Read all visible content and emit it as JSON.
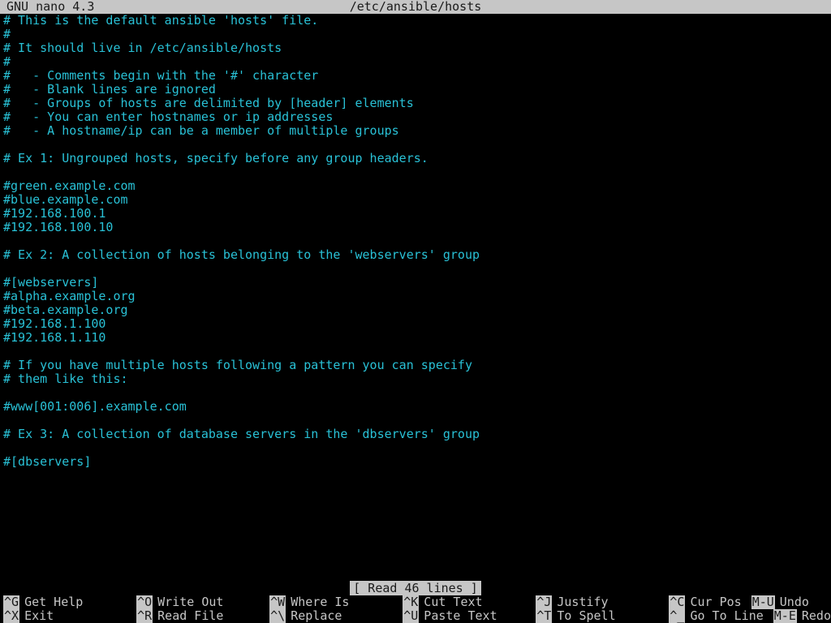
{
  "titlebar": {
    "app": "GNU nano 4.3",
    "file": "/etc/ansible/hosts"
  },
  "content_lines": [
    "# This is the default ansible 'hosts' file.",
    "#",
    "# It should live in /etc/ansible/hosts",
    "#",
    "#   - Comments begin with the '#' character",
    "#   - Blank lines are ignored",
    "#   - Groups of hosts are delimited by [header] elements",
    "#   - You can enter hostnames or ip addresses",
    "#   - A hostname/ip can be a member of multiple groups",
    "",
    "# Ex 1: Ungrouped hosts, specify before any group headers.",
    "",
    "#green.example.com",
    "#blue.example.com",
    "#192.168.100.1",
    "#192.168.100.10",
    "",
    "# Ex 2: A collection of hosts belonging to the 'webservers' group",
    "",
    "#[webservers]",
    "#alpha.example.org",
    "#beta.example.org",
    "#192.168.1.100",
    "#192.168.1.110",
    "",
    "# If you have multiple hosts following a pattern you can specify",
    "# them like this:",
    "",
    "#www[001:006].example.com",
    "",
    "# Ex 3: A collection of database servers in the 'dbservers' group",
    "",
    "#[dbservers]"
  ],
  "statusbar": {
    "message": "[ Read 46 lines ]"
  },
  "shortcuts": {
    "row1": [
      {
        "key": "^G",
        "label": "Get Help"
      },
      {
        "key": "^O",
        "label": "Write Out"
      },
      {
        "key": "^W",
        "label": "Where Is"
      },
      {
        "key": "^K",
        "label": "Cut Text"
      },
      {
        "key": "^J",
        "label": "Justify"
      },
      {
        "key": "^C",
        "label": "Cur Pos"
      }
    ],
    "row1_extra": {
      "key": "M-U",
      "label": "Undo"
    },
    "row2": [
      {
        "key": "^X",
        "label": "Exit"
      },
      {
        "key": "^R",
        "label": "Read File"
      },
      {
        "key": "^\\",
        "label": "Replace"
      },
      {
        "key": "^U",
        "label": "Paste Text"
      },
      {
        "key": "^T",
        "label": "To Spell"
      },
      {
        "key": "^_",
        "label": "Go To Line"
      }
    ],
    "row2_extra": {
      "key": "M-E",
      "label": "Redo"
    }
  }
}
